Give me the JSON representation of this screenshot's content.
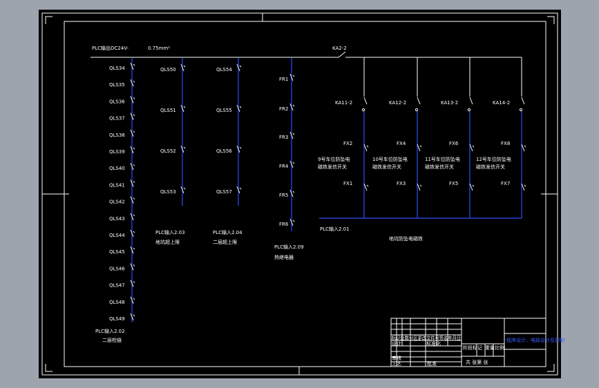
{
  "header": {
    "plc_output": "PLC输出DC24V-",
    "wire_size": "0.75mm²",
    "ka2": "KA2-2"
  },
  "column1": {
    "labels": [
      "QLS34",
      "QLS35",
      "QLS36",
      "QLS37",
      "QLS38",
      "QLS39",
      "QLS40",
      "QLS41",
      "QLS42",
      "QLS43",
      "QLS44",
      "QLS45",
      "QLS46",
      "QLS47",
      "QLS48",
      "QLS49"
    ],
    "caption1": "PLC输入2.02",
    "caption2": "二层检链"
  },
  "column2": {
    "labels": [
      "QLS50",
      "QLS51",
      "QLS52",
      "QLS53"
    ],
    "caption1": "PLC输入2.03",
    "caption2": "地坑超上限"
  },
  "column3": {
    "labels": [
      "QLS54",
      "QLS55",
      "QLS56",
      "QLS57"
    ],
    "caption1": "PLC输入2.04",
    "caption2": "二层超上限"
  },
  "column4": {
    "labels": [
      "FR1",
      "FR2",
      "FR3",
      "FR4",
      "FR5",
      "FR6"
    ],
    "caption1": "PLC输入2.09",
    "caption2": "热继电器"
  },
  "right_block": {
    "ka_labels": [
      "KA11-2",
      "KA12-2",
      "KA13-2",
      "KA14-2"
    ],
    "fx_top": [
      "FX2",
      "FX4",
      "FX6",
      "FX8"
    ],
    "desc_line1": [
      "9号车位防坠电",
      "10号车位防坠电",
      "11号车位防坠电",
      "12号车位防坠电"
    ],
    "desc_line2": [
      "磁铁发信开关",
      "磁铁发信开关",
      "磁铁发信开关",
      "磁铁发信开关"
    ],
    "fx_bottom": [
      "FX1",
      "FX3",
      "FX5",
      "FX7"
    ],
    "plc_input": "PLC输入2.01",
    "caption": "地坑防坠电磁铁"
  },
  "title_block": {
    "row1": "标记处数分区更改文件号签名年月日",
    "designer": "设计",
    "standardization": "标准化",
    "stage_mark": "阶段标记",
    "weight": "重量",
    "scale": "比例",
    "review": "审核",
    "process": "工艺",
    "approve": "批准",
    "sheets": "共  张第  张",
    "company": "程序设计、电路设计及控制"
  }
}
